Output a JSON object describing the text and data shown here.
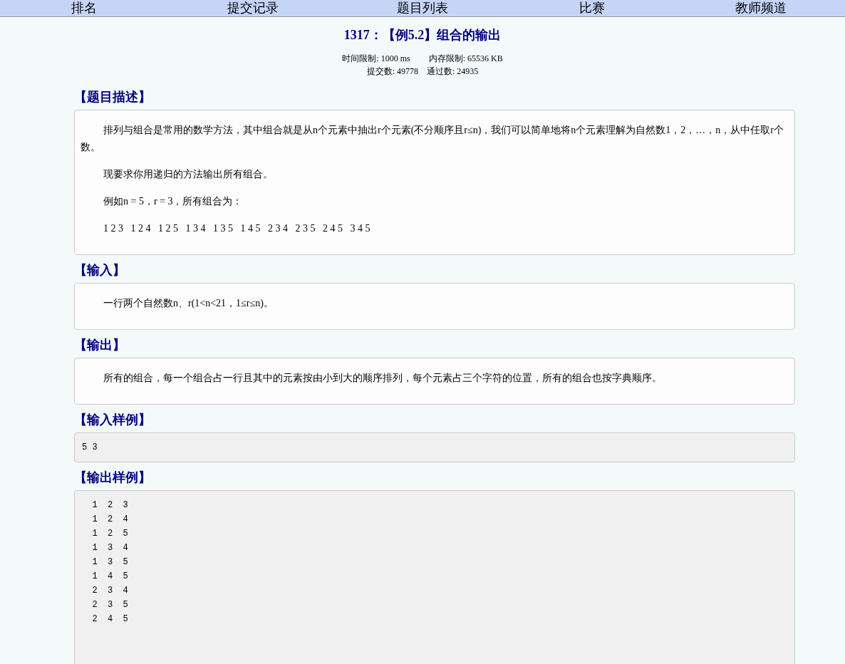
{
  "nav": {
    "items": [
      {
        "label": "排名"
      },
      {
        "label": "提交记录"
      },
      {
        "label": "题目列表"
      },
      {
        "label": "比赛"
      },
      {
        "label": "教师频道"
      }
    ]
  },
  "problem": {
    "title": "1317：【例5.2】组合的输出",
    "time_limit": "时间限制: 1000 ms",
    "memory_limit": "内存限制: 65536 KB",
    "submissions": "提交数: 49778",
    "accepted": "通过数: 24935"
  },
  "sections": [
    {
      "kind": "text",
      "heading": "【题目描述】",
      "paragraphs": [
        "排列与组合是常用的数学方法，其中组合就是从n个元素中抽出r个元素(不分顺序且r≤n)，我们可以简单地将n个元素理解为自然数1，2，…，n，从中任取r个数。",
        "现要求你用递归的方法输出所有组合。",
        "例如n = 5，r = 3，所有组合为：",
        "1 2 3   1 2 4   1 2 5   1 3 4   1 3 5   1 4 5   2 3 4   2 3 5   2 4 5   3 4 5"
      ]
    },
    {
      "kind": "text",
      "heading": "【输入】",
      "paragraphs": [
        "一行两个自然数n、r(1<n<21，1≤r≤n)。"
      ]
    },
    {
      "kind": "text",
      "heading": "【输出】",
      "paragraphs": [
        "所有的组合，每一个组合占一行且其中的元素按由小到大的顺序排列，每个元素占三个字符的位置，所有的组合也按字典顺序。"
      ]
    },
    {
      "kind": "code",
      "heading": "【输入样例】",
      "lines": [
        "5 3"
      ]
    },
    {
      "kind": "code",
      "heading": "【输出样例】",
      "lines": [
        "  1  2  3",
        "  1  2  4",
        "  1  2  5",
        "  1  3  4",
        "  1  3  5",
        "  1  4  5",
        "  2  3  4",
        "  2  3  5",
        "  2  4  5"
      ]
    }
  ]
}
